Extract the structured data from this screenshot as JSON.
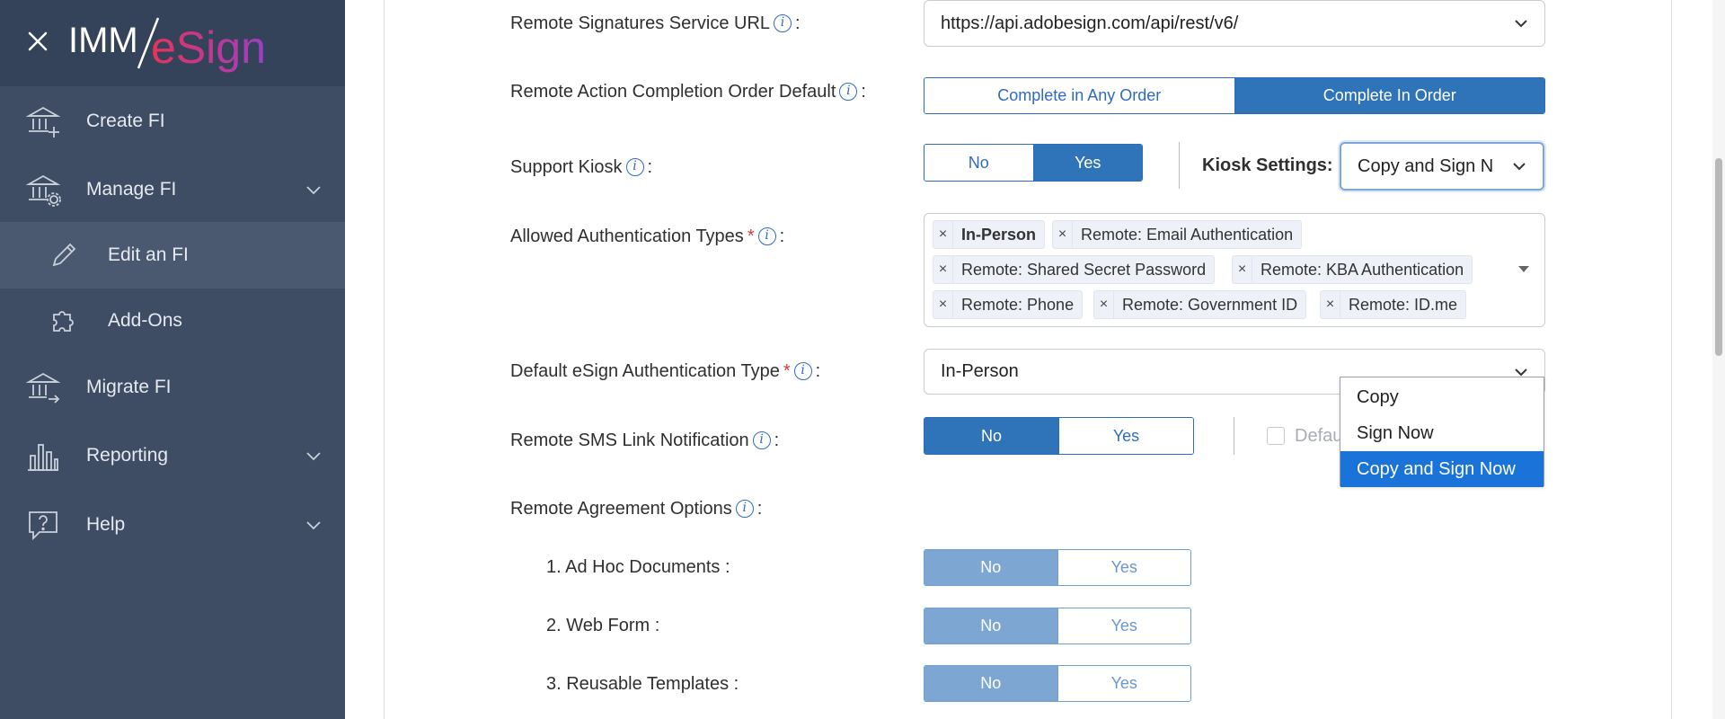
{
  "app": {
    "logo_prefix": "IMM",
    "logo_brand": "eSign"
  },
  "sidebar": {
    "items": [
      {
        "label": "Create FI",
        "icon": "bank-add-icon"
      },
      {
        "label": "Manage FI",
        "icon": "bank-gear-icon"
      },
      {
        "label": "Edit an FI",
        "icon": "pencil-icon"
      },
      {
        "label": "Add-Ons",
        "icon": "puzzle-icon"
      },
      {
        "label": "Migrate FI",
        "icon": "bank-arrow-icon"
      },
      {
        "label": "Reporting",
        "icon": "bar-chart-icon"
      },
      {
        "label": "Help",
        "icon": "help-bubble-icon"
      }
    ]
  },
  "form": {
    "service_url": {
      "label": "Remote Signatures Service URL",
      "value": "https://api.adobesign.com/api/rest/v6/"
    },
    "completion_order": {
      "label": "Remote Action Completion Order Default",
      "options": [
        "Complete in Any Order",
        "Complete In Order"
      ],
      "selected": "Complete In Order"
    },
    "support_kiosk": {
      "label": "Support Kiosk",
      "options": [
        "No",
        "Yes"
      ],
      "selected": "Yes"
    },
    "kiosk_settings": {
      "label": "Kiosk Settings:",
      "value": "Copy and Sign N"
    },
    "auth_types": {
      "label": "Allowed Authentication Types",
      "required_mark": "*",
      "tags": [
        "In-Person",
        "Remote: Email Authentication",
        "Remote: Shared Secret Password",
        "Remote: KBA Authentication",
        "Remote: Phone",
        "Remote: Government ID",
        "Remote: ID.me"
      ],
      "remove_symbol": "×"
    },
    "default_auth": {
      "label": "Default eSign Authentication Type",
      "required_mark": "*",
      "value": "In-Person"
    },
    "sms_notification": {
      "label": "Remote SMS Link Notification",
      "options": [
        "No",
        "Yes"
      ],
      "selected": "No",
      "default_checkbox_label": "Defau"
    },
    "agreement_options": {
      "label": "Remote Agreement Options",
      "items": [
        {
          "label": "1. Ad Hoc Documents :",
          "options": [
            "No",
            "Yes"
          ],
          "selected": "No"
        },
        {
          "label": "2. Web Form :",
          "options": [
            "No",
            "Yes"
          ],
          "selected": "No"
        },
        {
          "label": "3. Reusable Templates :",
          "options": [
            "No",
            "Yes"
          ],
          "selected": "No"
        }
      ]
    },
    "colon": ":"
  },
  "kiosk_dropdown": {
    "options": [
      "Copy",
      "Sign Now",
      "Copy and Sign Now"
    ],
    "selected": "Copy and Sign Now"
  },
  "colors": {
    "sidebar": "#3e4c64",
    "accent": "#2f74b8",
    "required": "#d93a3a",
    "selected_option": "#1a73d9"
  }
}
